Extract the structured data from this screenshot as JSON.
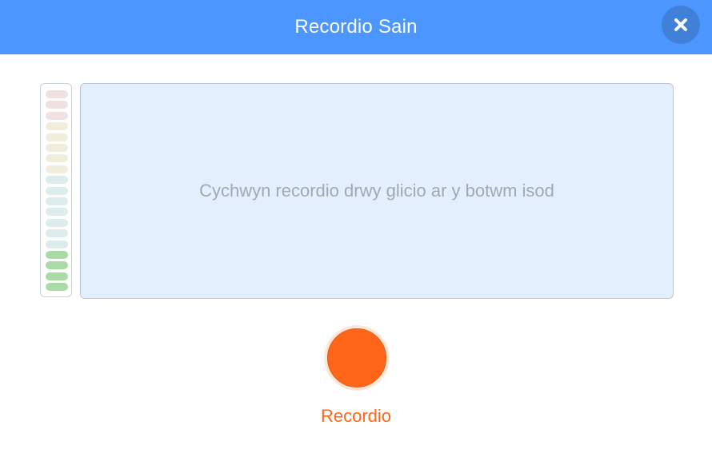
{
  "dialog": {
    "title": "Recordio Sain"
  },
  "preview": {
    "instructions": "Cychwyn recordio drwy glicio ar y botwm isod"
  },
  "record": {
    "label": "Recordio"
  },
  "meter": {
    "level": 0,
    "segments": [
      "#f0e1e1",
      "#f0e1e1",
      "#f0e1e1",
      "#f1eddc",
      "#f1eddc",
      "#f1eddc",
      "#f1eddc",
      "#f1eddc",
      "#dcebeb",
      "#dcebeb",
      "#dcebeb",
      "#dcebeb",
      "#dcebeb",
      "#dcebeb",
      "#dcebeb",
      "#a9dba6",
      "#a9dba6",
      "#a9dba6",
      "#a9dba6"
    ]
  },
  "colors": {
    "header": "#4c97ff",
    "record": "#ff661a",
    "preview_bg": "#e4effe"
  },
  "icons": {
    "close": "close-icon"
  }
}
